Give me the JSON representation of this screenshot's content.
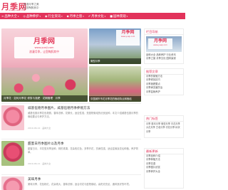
{
  "header": {
    "logo": "月季网",
    "logo_url": "www.yueji.com",
    "tagline_1": "浪漫月季之美",
    "tagline_2": "让您陶醉其中"
  },
  "nav": [
    {
      "icon": "≡",
      "label": "品种大全"
    },
    {
      "icon": "◎",
      "label": "品种养护"
    },
    {
      "icon": "◉",
      "label": "行业资讯"
    },
    {
      "icon": "◆",
      "label": "月季之窗"
    },
    {
      "icon": "✔",
      "label": "月季文化"
    },
    {
      "icon": "■",
      "label": "园林景观"
    }
  ],
  "banner": {
    "logo": "月季网",
    "url": "www.yueji.com",
    "slogan": "浪漫月季，让您陶醉其中",
    "caption": "月季花 · 如何月季花 修剪与施肥 · 花期管理 · 月季"
  },
  "thumbs": [
    {
      "logo": "月季网",
      "url": "www.yueji.com",
      "caption": "微型月季"
    },
    {
      "caption": "中国城市市花月季花的栽培特点和栽培"
    }
  ],
  "articles": [
    {
      "title": "威基伍德月季图片，威基伍德月季养殖方法",
      "desc": "威基伍德月季花色艳丽，香味浓郁，花期长，适应性强，是庭院栽培的优良品种，本文介绍威基伍德月季的栽培要点与养护方法。",
      "meta": "2019-06-12 · 品种大全"
    },
    {
      "title": "甜蜜日月季图片以及月季",
      "desc": "甜蜜日月，丰花型月季品种，株形紧凑，花朵玫红色，多季开花，抗病性强，适合盆栽及花坛种植，养护简单。",
      "meta": "2019-06-11 · 品种大全"
    },
    {
      "title": "美味月季",
      "desc": "美味月季，花色粉红，花朵硕大，香味浓郁，适合切花与庭院栽培，喜阳光充足、通风良好的环境。",
      "meta": "2019-06-10 · 品种大全"
    }
  ],
  "sidebar": {
    "panel1": {
      "head": "栏目导航",
      "logo": "月季网",
      "url": "www.yueji.com",
      "lines": [
        "品种大全 品种养护 行业资讯",
        "月季之窗 月季文化 园林景观"
      ]
    },
    "panel2": {
      "head": "推荐文章",
      "lines": [
        "月季的繁殖方法",
        "月季修剪技巧",
        "月季施肥要点",
        "月季病虫害防治",
        "月季盆栽养护"
      ]
    },
    "panel3": {
      "head": "热门标签",
      "tags": "月季 藤本月季 微型月季 丰花月季 大花月季 古老月季 切花月季 树状月季"
    },
    "panel4": {
      "head": "最新更新",
      "lines": [
        "月季品种介绍",
        "月季种植方法",
        "月季花语",
        "月季图片欣赏",
        "月季养护大全"
      ]
    }
  }
}
